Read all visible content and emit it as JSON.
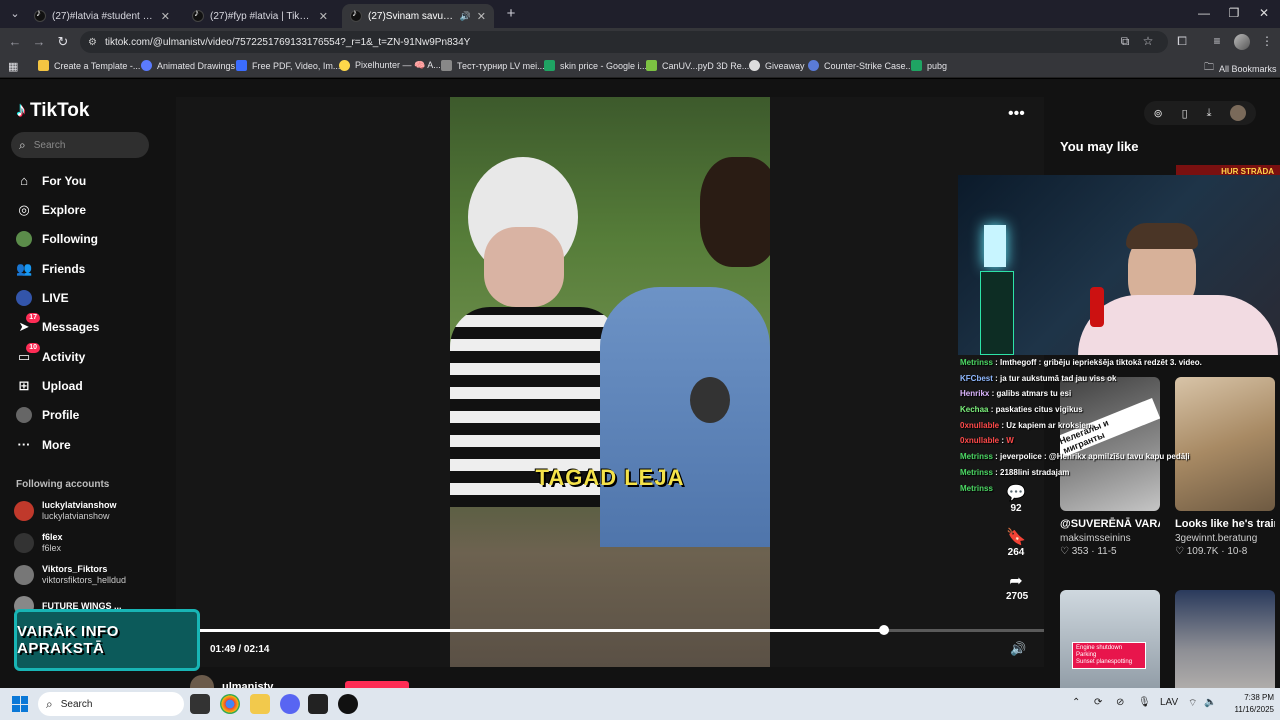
{
  "browser": {
    "tabs": [
      {
        "title": "(27)#latvia #student #srilankat",
        "active": false
      },
      {
        "title": "(27)#fyp #latvia | TikTok",
        "active": false
      },
      {
        "title": "(27)Svinam savus svētkus u",
        "active": true
      }
    ],
    "url": "tiktok.com/@ulmanistv/video/7572251769133176554?_r=1&_t=ZN-91Nw9Pn834Y",
    "bookmarks": [
      "Create a Template -...",
      "Animated Drawings",
      "Free PDF, Video, Im...",
      "Pixelhunter — 🧠 A...",
      "Тест-турнир LV mei...",
      "skin price - Google i...",
      "CanUV...pyD 3D Re...",
      "Giveaway",
      "Counter-Strike Case...",
      "pubg"
    ],
    "all_bookmarks": "All Bookmarks"
  },
  "tiktok": {
    "logo": "TikTok",
    "search_placeholder": "Search",
    "nav": {
      "for_you": "For You",
      "explore": "Explore",
      "following": "Following",
      "friends": "Friends",
      "live": "LIVE",
      "messages": "Messages",
      "messages_badge": "17",
      "activity": "Activity",
      "activity_badge": "10",
      "upload": "Upload",
      "profile": "Profile",
      "more": "More"
    },
    "following_title": "Following accounts",
    "following_accounts": [
      {
        "name": "luckylatvianshow",
        "handle": "luckylatvianshow"
      },
      {
        "name": "f6lex",
        "handle": "f6lex"
      },
      {
        "name": "Viktors_Fiktors",
        "handle": "viktorsfiktors_helldud"
      },
      {
        "name": "FUTURE WINGS ...",
        "handle": ""
      }
    ],
    "video": {
      "caption": "TAGAD LEJA",
      "time": "01:49 / 02:14",
      "progress": 0.81,
      "author": "ulmanistv"
    },
    "actions": {
      "comments": "92",
      "saves": "264",
      "shares": "2705"
    },
    "you_may_like": "You may like",
    "recommendations": [
      {
        "title": "@SUVERĒNĀ VARA @Rudibremanis...",
        "user": "maksimsseinins",
        "stats": "♡ 353 · 11-5",
        "overlay": "Нелегалы и мигранты"
      },
      {
        "title": "Looks like he's trained 😂 🕺 🌍 go...",
        "user": "3gewinnt.beratung",
        "stats": "♡ 109.7K · 10-8",
        "overlay": ""
      },
      {
        "title": "",
        "user": "",
        "stats": "",
        "overlay": "Engine shutdown\nParking\nSunset planespotting"
      },
      {
        "title": "",
        "user": "",
        "stats": "",
        "overlay": ""
      }
    ],
    "corner_thumb_text": "HUR STRĀDA"
  },
  "stream": {
    "chat": [
      {
        "user": "Metrinss",
        "msg": "Imthegoff : gribēju iepriekšēja tiktokā redzēt 3. video.",
        "color": "#4cd964"
      },
      {
        "user": "KFCbest",
        "msg": "ja tur aukstumā tad jau viss ok",
        "color": "#8fb8ff"
      },
      {
        "user": "Henrikx",
        "msg": "galibs atmars tu esi",
        "color": "#dcb6ff"
      },
      {
        "user": "Kechaa",
        "msg": "paskaties citus vigikus",
        "color": "#7bf07b"
      },
      {
        "user": "0xnullable",
        "msg": "Uz kapiem ar kroksiem",
        "color": "#ff4a4a"
      },
      {
        "user": "0xnullable",
        "msg": "W",
        "color": "#ff4a4a"
      },
      {
        "user": "Metrinss",
        "msg": "jeverpolice : @Henrikx apmilzīšu tavu kapu pedāļi",
        "color": "#4cd964"
      },
      {
        "user": "Metrinss",
        "msg": "2188lini stradajam",
        "color": "#4cd964"
      },
      {
        "user": "Metrinss",
        "msg": "",
        "color": "#4cd964"
      }
    ],
    "promo": "VAIRĀK INFO APRAKSTĀ"
  },
  "taskbar": {
    "search": "Search",
    "lang": "LAV",
    "time": "7:38 PM",
    "date": "11/16/2025"
  }
}
